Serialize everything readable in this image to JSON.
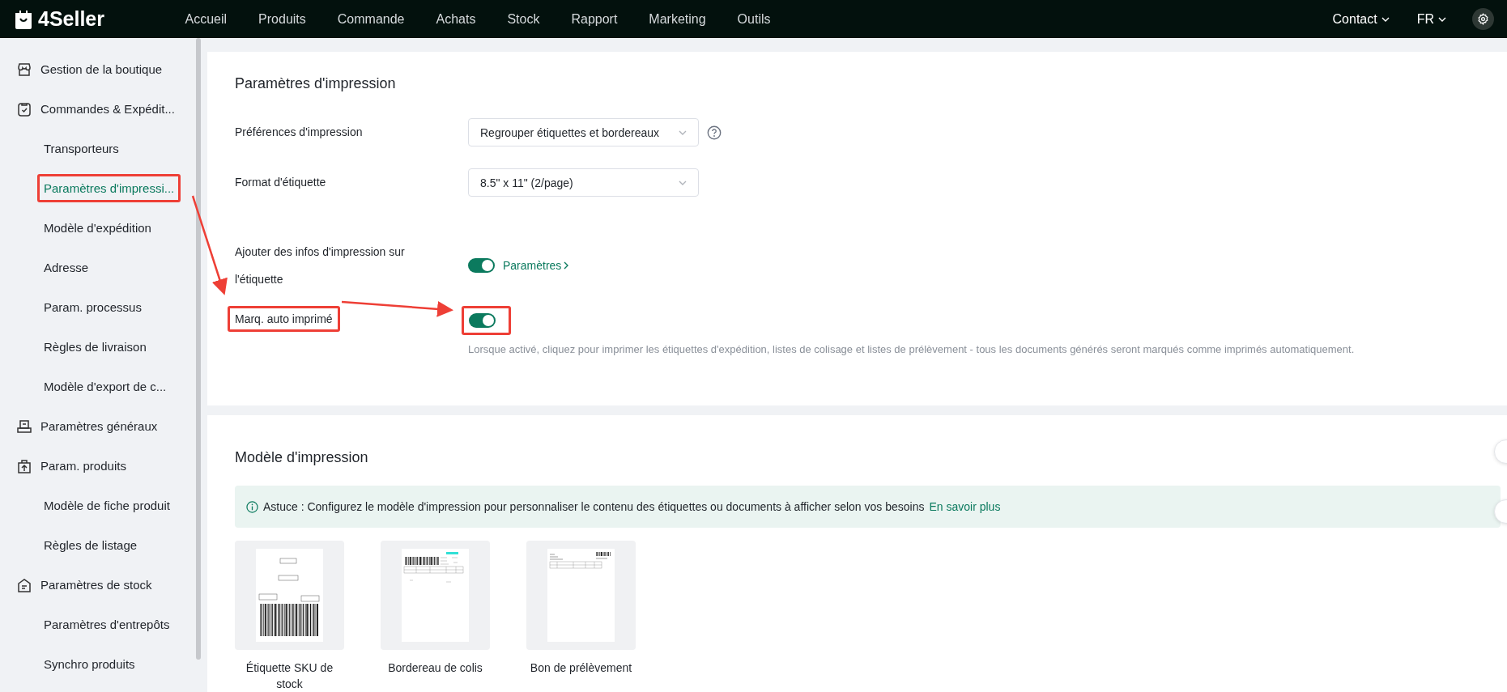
{
  "brand": "4Seller",
  "nav": [
    {
      "label": "Accueil"
    },
    {
      "label": "Produits"
    },
    {
      "label": "Commande"
    },
    {
      "label": "Achats"
    },
    {
      "label": "Stock"
    },
    {
      "label": "Rapport"
    },
    {
      "label": "Marketing"
    },
    {
      "label": "Outils"
    }
  ],
  "top_right": {
    "contact": "Contact",
    "language": "FR"
  },
  "sidebar": {
    "groups": [
      {
        "label": "Gestion de la boutique"
      },
      {
        "label": "Commandes & Expédit...",
        "children": [
          {
            "label": "Transporteurs",
            "selected": false,
            "annotated": false
          },
          {
            "label": "Paramètres d'impressi...",
            "selected": true,
            "annotated": true
          },
          {
            "label": "Modèle d'expédition",
            "selected": false,
            "annotated": false
          },
          {
            "label": "Adresse",
            "selected": false,
            "annotated": false
          },
          {
            "label": "Param. processus",
            "selected": false,
            "annotated": false
          },
          {
            "label": "Règles de livraison",
            "selected": false,
            "annotated": false
          },
          {
            "label": "Modèle d'export de c...",
            "selected": false,
            "annotated": false
          }
        ]
      },
      {
        "label": "Paramètres généraux"
      },
      {
        "label": "Param. produits",
        "children": [
          {
            "label": "Modèle de fiche produit",
            "selected": false,
            "annotated": false
          },
          {
            "label": "Règles de listage",
            "selected": false,
            "annotated": false
          }
        ]
      },
      {
        "label": "Paramètres de stock",
        "children": [
          {
            "label": "Paramètres d'entrepôts",
            "selected": false,
            "annotated": false
          },
          {
            "label": "Synchro produits",
            "selected": false,
            "annotated": false
          }
        ]
      }
    ]
  },
  "print_settings": {
    "title": "Paramètres d'impression",
    "rows": [
      {
        "kind": "select",
        "label": "Préférences d'impression",
        "value": "Regrouper étiquettes et bordereaux",
        "help": true,
        "annotated": false
      },
      {
        "kind": "select",
        "label": "Format d'étiquette",
        "value": "8.5\" x 11\" (2/page)",
        "annotated": false
      },
      {
        "kind": "toggle",
        "label": "Ajouter des infos d'impression sur l'étiquette",
        "on": true,
        "link": "Paramètres",
        "annotated": false
      },
      {
        "kind": "toggle",
        "label": "Marq. auto imprimé",
        "on": true,
        "description": "Lorsque activé, cliquez pour imprimer les étiquettes d'expédition, listes de colisage et listes de prélèvement - tous les documents générés seront marqués comme imprimés automatiquement.",
        "annotated": true
      }
    ]
  },
  "print_templates": {
    "title": "Modèle d'impression",
    "tip": {
      "text": "Astuce : Configurez le modèle d'impression pour personnaliser le contenu des étiquettes ou documents à afficher selon vos besoins",
      "link": "En savoir plus"
    },
    "templates": [
      {
        "kind": "sku_label",
        "caption": "Étiquette SKU de stock"
      },
      {
        "kind": "packing_slip",
        "caption": "Bordereau de colis"
      },
      {
        "kind": "pick_list",
        "caption": "Bon de prélèvement"
      }
    ]
  }
}
